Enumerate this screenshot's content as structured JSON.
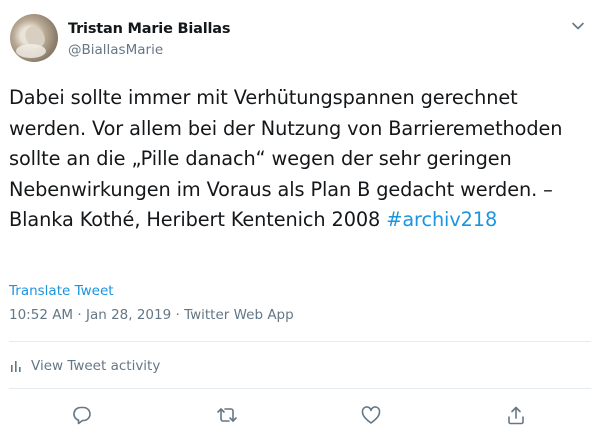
{
  "author": {
    "name": "Tristan Marie Biallas",
    "handle": "@BiallasMarie"
  },
  "tweet": {
    "text": "Dabei sollte immer mit Verhütungspannen gerechnet werden. Vor allem bei der Nutzung von Barrieremethoden sollte an die „Pille danach“ wegen der sehr geringen Nebenwirkungen im Voraus als Plan B gedacht werden. – Blanka Kothé, Heribert Kentenich 2008",
    "hashtag": "#archiv218",
    "translate_label": "Translate Tweet",
    "time": "10:52 AM",
    "date": "Jan 28, 2019",
    "source": "Twitter Web App",
    "separator": " · "
  },
  "activity": {
    "label": "View Tweet activity"
  },
  "icons": {
    "more": "chevron-down-icon",
    "activity": "bar-chart-icon",
    "reply": "speech-bubble-icon",
    "retweet": "retweet-icon",
    "like": "heart-icon",
    "share": "share-upload-icon"
  },
  "colors": {
    "link": "#1b95e0",
    "secondary_text": "#657786",
    "primary_text": "#14171a",
    "divider": "#e6ecf0"
  }
}
